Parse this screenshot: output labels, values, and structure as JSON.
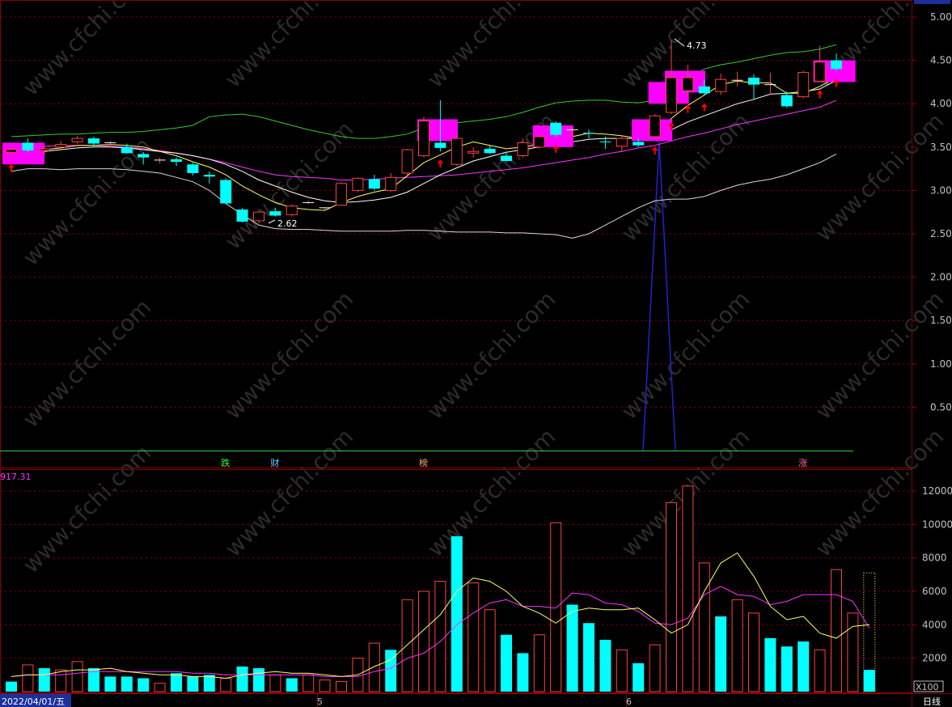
{
  "colors": {
    "background": "#000000",
    "frame": "#8b0000",
    "grid": "#8b0000",
    "up": "#ff4040",
    "down": "#00ffff",
    "ma5": "#ffff66",
    "ma10": "#ffffff",
    "ma20": "#ff33ff",
    "boll_upper": "#33cc33",
    "boll_lower": "#d8d8d8",
    "box": "#ff00ff",
    "arrow": "#ff0000",
    "spike": "#2222cc",
    "vol_ma5": "#ffff66",
    "vol_ma10": "#ff33ff"
  },
  "status_bar": {
    "date": "2022/04/01/五",
    "month_marks": [
      "5",
      "6"
    ],
    "period": "日线",
    "vol_unit": "X100"
  },
  "annotations": {
    "high_label": "4.73",
    "low_label": "2.62",
    "vol_readout": "917.31"
  },
  "signals": [
    {
      "text": "跌",
      "color": "#33ff33",
      "index": 13
    },
    {
      "text": "财",
      "color": "#66ccff",
      "index": 16
    },
    {
      "text": "榜",
      "color": "#ffaa66",
      "index": 25
    },
    {
      "text": "涨",
      "color": "#ff66aa",
      "index": 48
    }
  ],
  "chart_data": [
    {
      "type": "candlestick",
      "ylim": [
        0,
        5.2
      ],
      "y_ticks": [
        5.0,
        4.5,
        4.0,
        3.5,
        3.0,
        2.5,
        2.0,
        1.5,
        1.0,
        0.5
      ],
      "candles": [
        {
          "o": 3.44,
          "h": 3.5,
          "l": 3.4,
          "c": 3.47
        },
        {
          "o": 3.55,
          "h": 3.6,
          "l": 3.44,
          "c": 3.46
        },
        {
          "o": 3.46,
          "h": 3.5,
          "l": 3.42,
          "c": 3.48
        },
        {
          "o": 3.5,
          "h": 3.57,
          "l": 3.48,
          "c": 3.53
        },
        {
          "o": 3.56,
          "h": 3.63,
          "l": 3.54,
          "c": 3.6
        },
        {
          "o": 3.6,
          "h": 3.62,
          "l": 3.52,
          "c": 3.54
        },
        {
          "o": 3.55,
          "h": 3.57,
          "l": 3.5,
          "c": 3.55
        },
        {
          "o": 3.5,
          "h": 3.54,
          "l": 3.42,
          "c": 3.43
        },
        {
          "o": 3.42,
          "h": 3.44,
          "l": 3.3,
          "c": 3.38
        },
        {
          "o": 3.35,
          "h": 3.38,
          "l": 3.31,
          "c": 3.35
        },
        {
          "o": 3.36,
          "h": 3.38,
          "l": 3.28,
          "c": 3.33
        },
        {
          "o": 3.3,
          "h": 3.32,
          "l": 3.17,
          "c": 3.2
        },
        {
          "o": 3.18,
          "h": 3.22,
          "l": 3.08,
          "c": 3.16
        },
        {
          "o": 3.12,
          "h": 3.14,
          "l": 2.84,
          "c": 2.85
        },
        {
          "o": 2.78,
          "h": 2.8,
          "l": 2.63,
          "c": 2.64
        },
        {
          "o": 2.65,
          "h": 2.76,
          "l": 2.62,
          "c": 2.75
        },
        {
          "o": 2.76,
          "h": 2.8,
          "l": 2.7,
          "c": 2.71
        },
        {
          "o": 2.72,
          "h": 2.84,
          "l": 2.7,
          "c": 2.82
        },
        {
          "o": 2.85,
          "h": 2.88,
          "l": 2.84,
          "c": 2.86
        },
        {
          "o": 2.79,
          "h": 2.81,
          "l": 2.78,
          "c": 2.8
        },
        {
          "o": 2.83,
          "h": 3.1,
          "l": 2.82,
          "c": 3.08
        },
        {
          "o": 3.0,
          "h": 3.15,
          "l": 2.98,
          "c": 3.14
        },
        {
          "o": 3.13,
          "h": 3.18,
          "l": 3.0,
          "c": 3.02
        },
        {
          "o": 3.0,
          "h": 3.2,
          "l": 2.98,
          "c": 3.15
        },
        {
          "o": 3.2,
          "h": 3.48,
          "l": 3.18,
          "c": 3.47
        },
        {
          "o": 3.4,
          "h": 3.85,
          "l": 3.38,
          "c": 3.8
        },
        {
          "o": 3.55,
          "h": 4.04,
          "l": 3.45,
          "c": 3.49
        },
        {
          "o": 3.3,
          "h": 3.65,
          "l": 3.28,
          "c": 3.6
        },
        {
          "o": 3.43,
          "h": 3.5,
          "l": 3.38,
          "c": 3.45
        },
        {
          "o": 3.48,
          "h": 3.52,
          "l": 3.42,
          "c": 3.43
        },
        {
          "o": 3.4,
          "h": 3.45,
          "l": 3.33,
          "c": 3.34
        },
        {
          "o": 3.4,
          "h": 3.6,
          "l": 3.38,
          "c": 3.55
        },
        {
          "o": 3.5,
          "h": 3.66,
          "l": 3.48,
          "c": 3.62
        },
        {
          "o": 3.78,
          "h": 3.8,
          "l": 3.62,
          "c": 3.64
        },
        {
          "o": 3.7,
          "h": 3.74,
          "l": 3.62,
          "c": 3.7
        },
        {
          "o": 3.66,
          "h": 3.7,
          "l": 3.6,
          "c": 3.65
        },
        {
          "o": 3.56,
          "h": 3.62,
          "l": 3.48,
          "c": 3.55
        },
        {
          "o": 3.51,
          "h": 3.62,
          "l": 3.45,
          "c": 3.6
        },
        {
          "o": 3.56,
          "h": 3.6,
          "l": 3.5,
          "c": 3.52
        },
        {
          "o": 3.62,
          "h": 3.88,
          "l": 3.6,
          "c": 3.86
        },
        {
          "o": 3.9,
          "h": 4.73,
          "l": 3.88,
          "c": 4.3
        },
        {
          "o": 4.15,
          "h": 4.45,
          "l": 4.08,
          "c": 4.3
        },
        {
          "o": 4.2,
          "h": 4.28,
          "l": 4.1,
          "c": 4.12
        },
        {
          "o": 4.14,
          "h": 4.35,
          "l": 4.1,
          "c": 4.28
        },
        {
          "o": 4.27,
          "h": 4.37,
          "l": 4.2,
          "c": 4.27
        },
        {
          "o": 4.3,
          "h": 4.34,
          "l": 4.05,
          "c": 4.22
        },
        {
          "o": 4.22,
          "h": 4.36,
          "l": 4.1,
          "c": 4.22
        },
        {
          "o": 4.1,
          "h": 4.14,
          "l": 3.95,
          "c": 3.97
        },
        {
          "o": 4.08,
          "h": 4.38,
          "l": 4.06,
          "c": 4.36
        },
        {
          "o": 4.26,
          "h": 4.67,
          "l": 4.25,
          "c": 4.48
        },
        {
          "o": 4.5,
          "h": 4.58,
          "l": 4.38,
          "c": 4.4
        }
      ],
      "ma5": [
        3.45,
        3.46,
        3.47,
        3.49,
        3.52,
        3.52,
        3.53,
        3.52,
        3.5,
        3.45,
        3.4,
        3.33,
        3.27,
        3.18,
        3.05,
        2.95,
        2.86,
        2.8,
        2.78,
        2.77,
        2.86,
        2.93,
        2.98,
        3.02,
        3.17,
        3.32,
        3.41,
        3.5,
        3.56,
        3.52,
        3.48,
        3.5,
        3.53,
        3.56,
        3.62,
        3.66,
        3.65,
        3.63,
        3.6,
        3.64,
        3.83,
        3.98,
        4.1,
        4.22,
        4.26,
        4.24,
        4.24,
        4.12,
        4.12,
        4.2,
        4.3
      ],
      "ma10": [
        3.42,
        3.44,
        3.45,
        3.47,
        3.49,
        3.5,
        3.5,
        3.49,
        3.47,
        3.45,
        3.43,
        3.4,
        3.36,
        3.3,
        3.22,
        3.12,
        3.05,
        2.98,
        2.92,
        2.88,
        2.86,
        2.87,
        2.89,
        2.92,
        2.98,
        3.08,
        3.18,
        3.26,
        3.34,
        3.39,
        3.44,
        3.47,
        3.5,
        3.53,
        3.56,
        3.59,
        3.6,
        3.6,
        3.6,
        3.63,
        3.7,
        3.79,
        3.86,
        3.93,
        4.0,
        4.05,
        4.11,
        4.12,
        4.14,
        4.17,
        4.27
      ],
      "ma20": [
        3.48,
        3.5,
        3.51,
        3.52,
        3.52,
        3.52,
        3.51,
        3.5,
        3.48,
        3.46,
        3.43,
        3.4,
        3.36,
        3.32,
        3.27,
        3.22,
        3.18,
        3.16,
        3.15,
        3.14,
        3.12,
        3.12,
        3.13,
        3.14,
        3.15,
        3.16,
        3.17,
        3.18,
        3.2,
        3.22,
        3.24,
        3.26,
        3.29,
        3.32,
        3.35,
        3.38,
        3.42,
        3.45,
        3.49,
        3.52,
        3.57,
        3.62,
        3.66,
        3.71,
        3.76,
        3.8,
        3.84,
        3.88,
        3.92,
        3.96,
        4.04
      ],
      "boll_upper": [
        3.62,
        3.63,
        3.64,
        3.65,
        3.65,
        3.66,
        3.67,
        3.67,
        3.68,
        3.7,
        3.72,
        3.75,
        3.85,
        3.87,
        3.88,
        3.85,
        3.8,
        3.75,
        3.7,
        3.66,
        3.62,
        3.6,
        3.6,
        3.62,
        3.65,
        3.72,
        3.76,
        3.78,
        3.8,
        3.82,
        3.85,
        3.9,
        3.96,
        4.01,
        4.03,
        4.04,
        4.04,
        4.02,
        4.01,
        4.04,
        4.18,
        4.3,
        4.4,
        4.45,
        4.48,
        4.52,
        4.56,
        4.59,
        4.6,
        4.63,
        4.68
      ],
      "boll_lower": [
        3.22,
        3.25,
        3.25,
        3.24,
        3.25,
        3.25,
        3.25,
        3.24,
        3.22,
        3.2,
        3.15,
        3.1,
        3.0,
        2.85,
        2.72,
        2.6,
        2.56,
        2.55,
        2.55,
        2.54,
        2.53,
        2.53,
        2.53,
        2.53,
        2.54,
        2.54,
        2.53,
        2.52,
        2.52,
        2.52,
        2.51,
        2.51,
        2.5,
        2.49,
        2.45,
        2.5,
        2.6,
        2.7,
        2.8,
        2.88,
        2.9,
        2.9,
        2.93,
        3.0,
        3.06,
        3.1,
        3.13,
        3.18,
        3.25,
        3.32,
        3.42
      ]
    },
    {
      "type": "bar",
      "ylim": [
        0,
        13000
      ],
      "y_ticks": [
        12000,
        10000,
        8000,
        6000,
        4000,
        2000
      ],
      "unit": "X100",
      "volume": [
        600,
        1600,
        1400,
        1300,
        1800,
        1400,
        900,
        900,
        800,
        500,
        1100,
        900,
        1000,
        800,
        1500,
        1400,
        1000,
        800,
        1000,
        700,
        600,
        2000,
        2900,
        2500,
        5500,
        6000,
        6600,
        9300,
        6500,
        4900,
        3400,
        2300,
        3400,
        10100,
        5200,
        4100,
        3100,
        2500,
        1700,
        2800,
        11300,
        12300,
        7700,
        4500,
        5500,
        4700,
        3200,
        2700,
        3000,
        2500,
        7300,
        4700,
        1300
      ],
      "vol_up": [
        false,
        true,
        false,
        true,
        true,
        false,
        false,
        false,
        false,
        true,
        false,
        false,
        false,
        true,
        false,
        false,
        true,
        false,
        true,
        true,
        true,
        true,
        true,
        false,
        true,
        true,
        true,
        false,
        true,
        true,
        false,
        false,
        true,
        true,
        false,
        false,
        false,
        true,
        false,
        true,
        true,
        true,
        true,
        false,
        true,
        true,
        false,
        false,
        false,
        true,
        true,
        true,
        false
      ],
      "vol_ma5": [
        900,
        1000,
        1000,
        1200,
        1300,
        1300,
        1400,
        1200,
        1100,
        1000,
        1000,
        900,
        900,
        800,
        1000,
        1100,
        1200,
        1100,
        1100,
        1000,
        900,
        1000,
        1500,
        1900,
        2800,
        3700,
        4600,
        6000,
        6800,
        6600,
        6000,
        5100,
        4700,
        4100,
        4800,
        5000,
        4900,
        4900,
        5000,
        4300,
        3500,
        4000,
        6000,
        7700,
        8300,
        6900,
        5100,
        4300,
        4500,
        3500,
        3200,
        3900,
        4000
      ],
      "vol_ma10": [
        900,
        1000,
        1000,
        1000,
        1100,
        1200,
        1200,
        1200,
        1200,
        1200,
        1200,
        1100,
        1100,
        1000,
        1000,
        1000,
        1000,
        1000,
        1000,
        900,
        900,
        900,
        1200,
        1400,
        2000,
        2300,
        3000,
        4000,
        4700,
        5300,
        5500,
        5100,
        5100,
        5000,
        5900,
        5800,
        5300,
        5200,
        4800,
        4100,
        4000,
        4400,
        5800,
        6300,
        5800,
        5700,
        5200,
        5400,
        5800,
        5800,
        5800,
        5400,
        3800
      ]
    }
  ]
}
